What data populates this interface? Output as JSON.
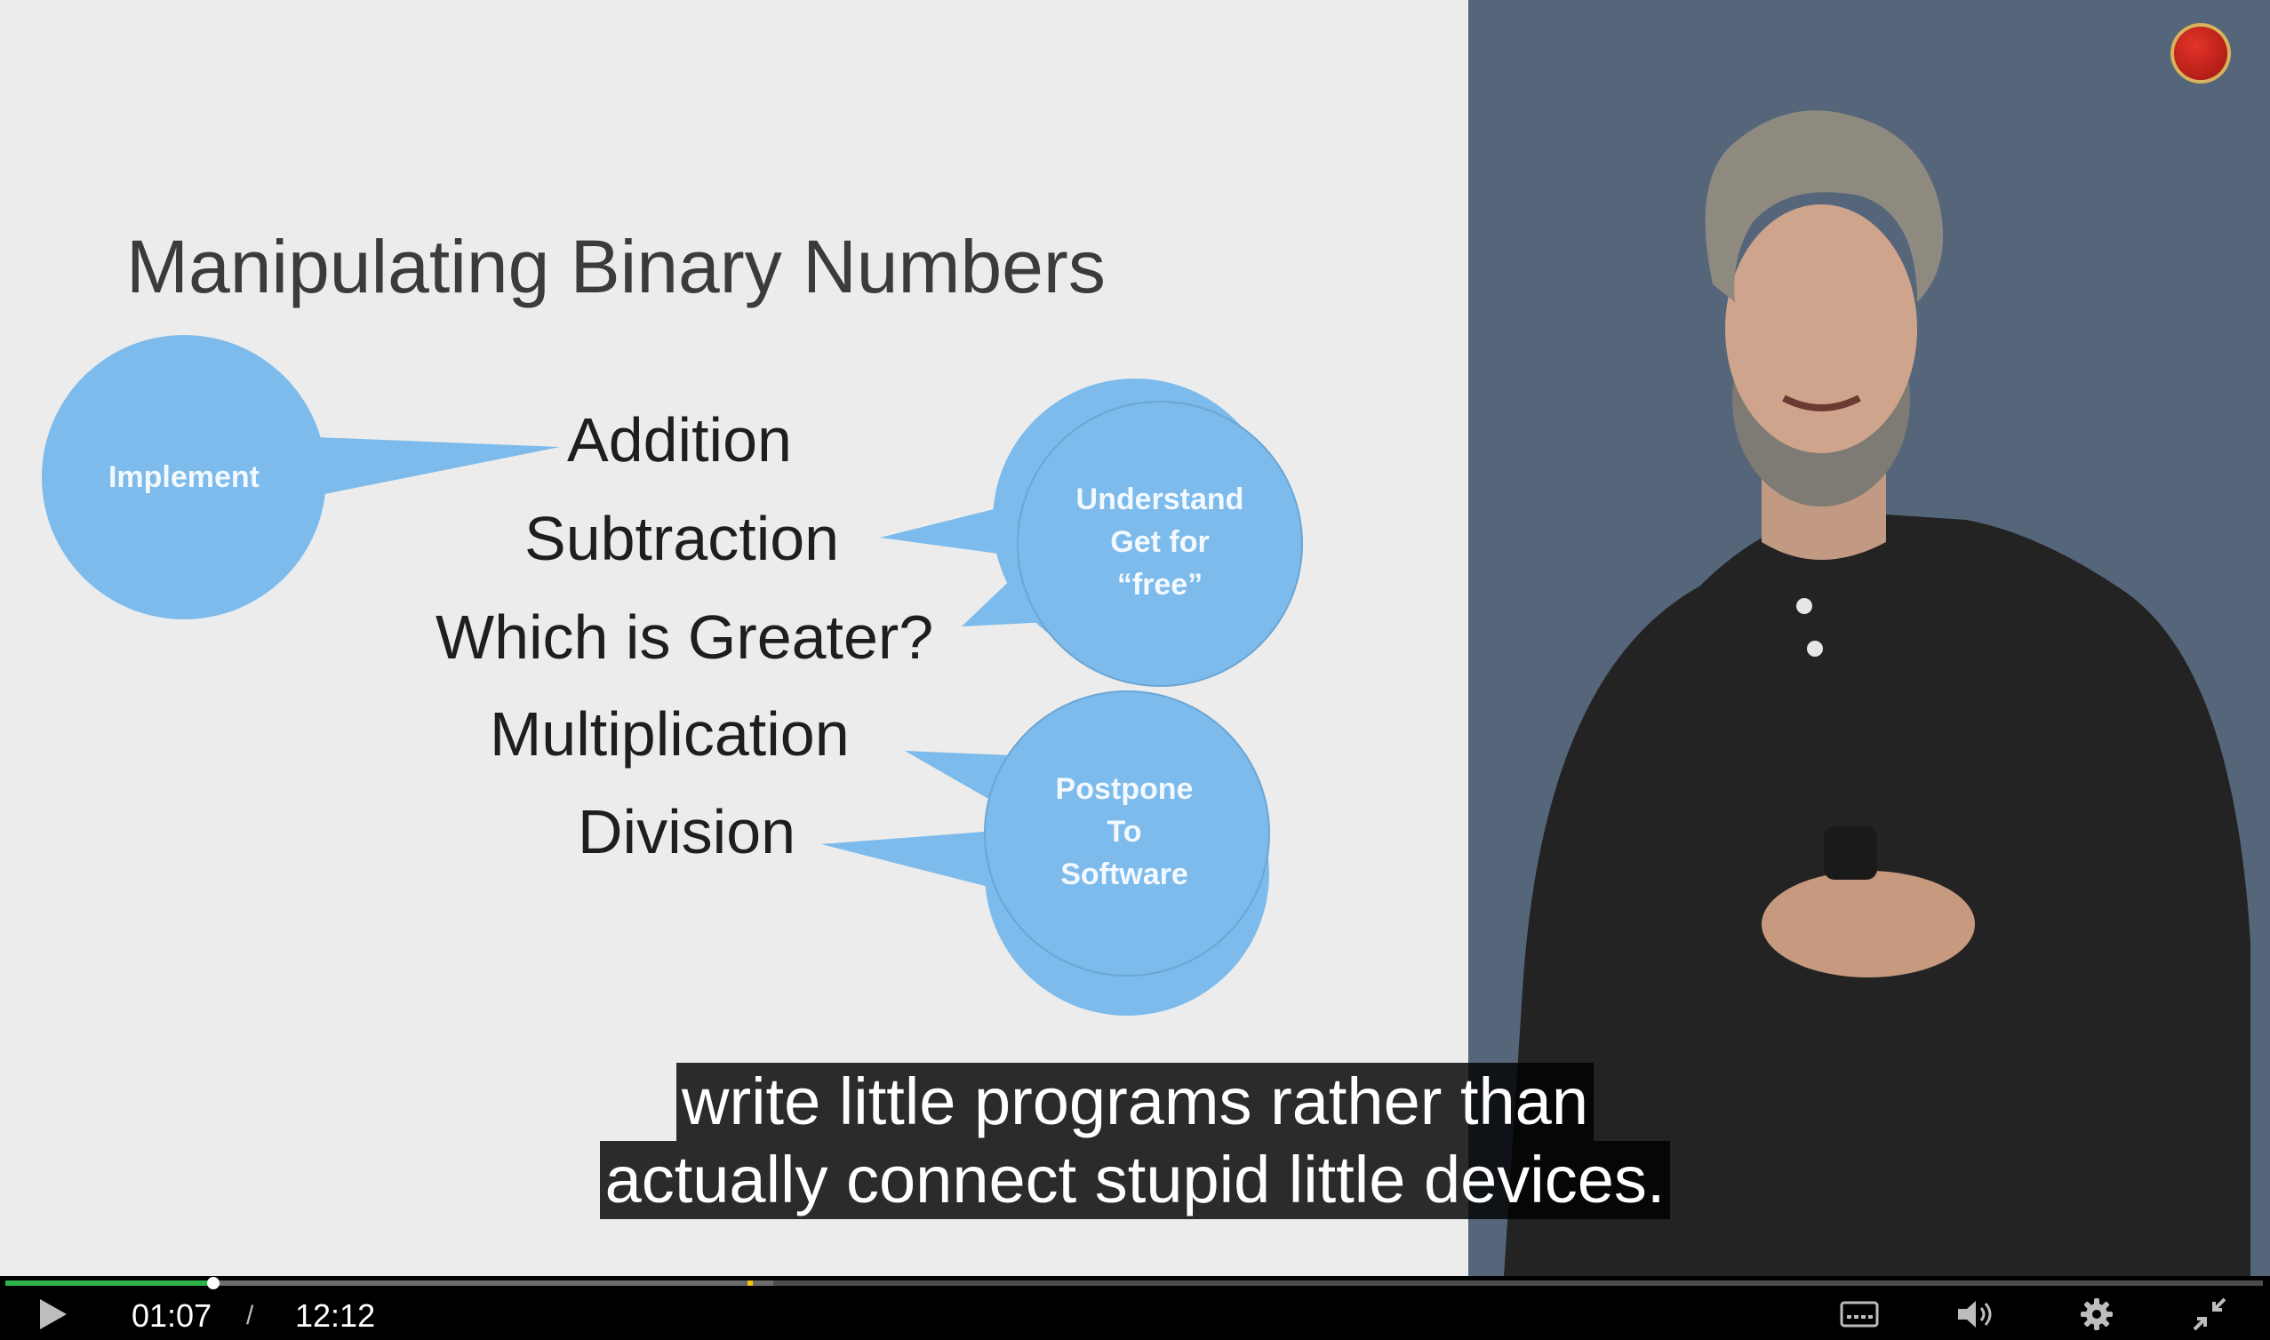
{
  "slide": {
    "title": "Manipulating Binary Numbers",
    "operations": [
      "Addition",
      "Subtraction",
      "Which is Greater?",
      "Multiplication",
      "Division"
    ],
    "bubbles": {
      "implement": "Implement",
      "understand": [
        "Understand",
        "Get for",
        "“free”"
      ],
      "postpone": [
        "Postpone",
        "To",
        "Software"
      ]
    },
    "bubble_color": "#7cbbeb"
  },
  "captions": {
    "line1": "write little programs rather than",
    "line2": "actually connect stupid little devices."
  },
  "player": {
    "current_time": "01:07",
    "separator": "/",
    "duration": "12:12",
    "progress_fraction": 0.092,
    "buffered_fraction": 0.34,
    "accent_color": "#2db34a",
    "chapter_marker_color": "#f1c40f",
    "icons": [
      "play-icon",
      "captions-icon",
      "volume-icon",
      "settings-icon",
      "exit-fullscreen-icon"
    ]
  }
}
